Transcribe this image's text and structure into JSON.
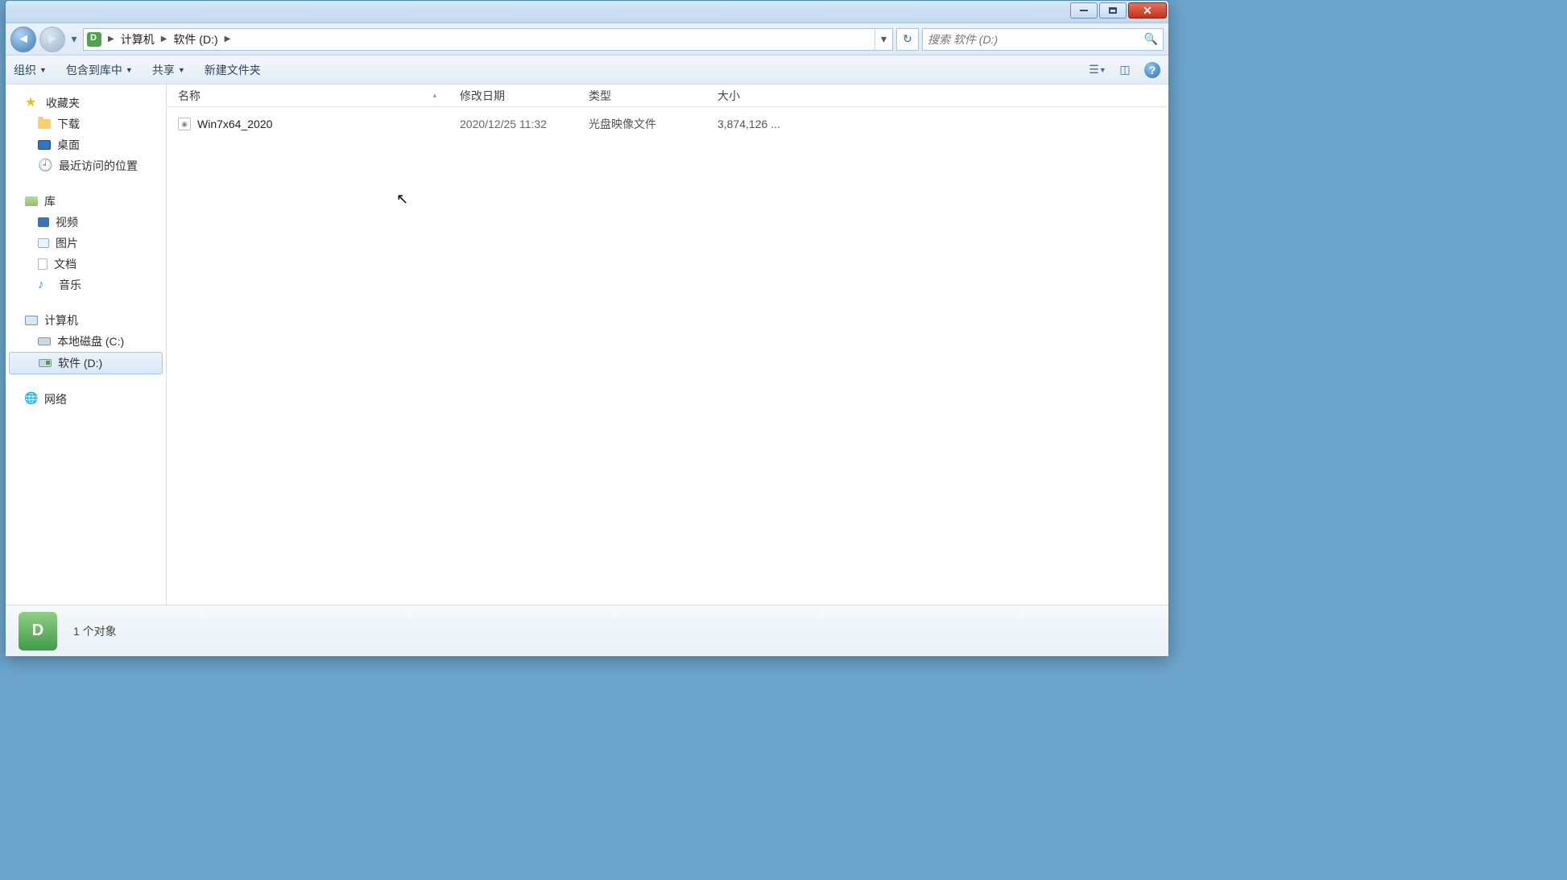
{
  "breadcrumb": {
    "root": "计算机",
    "current": "软件 (D:)"
  },
  "search": {
    "placeholder": "搜索 软件 (D:)"
  },
  "toolbar": {
    "organize": "组织",
    "include": "包含到库中",
    "share": "共享",
    "newfolder": "新建文件夹"
  },
  "sidebar": {
    "favorites": {
      "label": "收藏夹",
      "items": [
        "下载",
        "桌面",
        "最近访问的位置"
      ]
    },
    "libraries": {
      "label": "库",
      "items": [
        "视频",
        "图片",
        "文档",
        "音乐"
      ]
    },
    "computer": {
      "label": "计算机",
      "items": [
        "本地磁盘 (C:)",
        "软件 (D:)"
      ]
    },
    "network": {
      "label": "网络"
    }
  },
  "columns": {
    "name": "名称",
    "date": "修改日期",
    "type": "类型",
    "size": "大小"
  },
  "files": [
    {
      "name": "Win7x64_2020",
      "date": "2020/12/25 11:32",
      "type": "光盘映像文件",
      "size": "3,874,126 ..."
    }
  ],
  "status": {
    "text": "1 个对象"
  },
  "help_glyph": "?"
}
